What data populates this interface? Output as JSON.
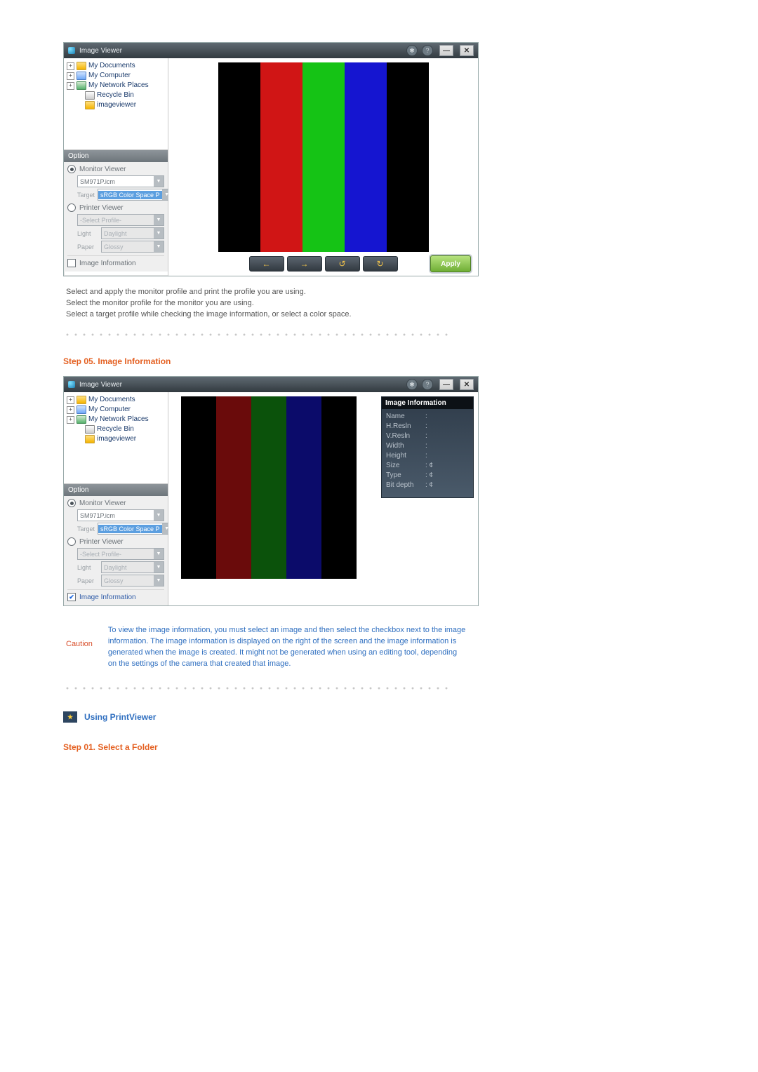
{
  "screenshot1": {
    "title": "Image Viewer",
    "tree": {
      "items": [
        {
          "label": "My Documents",
          "exp": "+",
          "icon": "folder"
        },
        {
          "label": "My Computer",
          "exp": "+",
          "icon": "comp"
        },
        {
          "label": "My Network Places",
          "exp": "+",
          "icon": "net"
        },
        {
          "label": "Recycle Bin",
          "exp": " ",
          "icon": "bin",
          "indent": 1
        },
        {
          "label": "imageviewer",
          "exp": " ",
          "icon": "folder",
          "indent": 1
        }
      ]
    },
    "option_header": "Option",
    "monitor_viewer": {
      "label": "Monitor Viewer",
      "selected": true
    },
    "profile_value": "SM971P.icm",
    "target_label": "Target",
    "target_value": "sRGB Color Space P",
    "printer_viewer": {
      "label": "Printer Viewer",
      "selected": false
    },
    "printer_profile_value": "-Select Profile-",
    "light_label": "Light",
    "light_value": "Daylight",
    "paper_label": "Paper",
    "paper_value": "Glossy",
    "image_info_label": "Image Information",
    "image_info_checked": false,
    "apply_label": "Apply",
    "nav": {
      "back": "←",
      "fwd": "→",
      "rot1": "↺",
      "rot2": "↻"
    },
    "bars": [
      "#000000",
      "#d01515",
      "#15c315",
      "#1515d0",
      "#000000"
    ]
  },
  "screenshot2": {
    "title": "Image Viewer",
    "info_panel": {
      "title": "Image Information",
      "rows": [
        {
          "k": "Name",
          "v": ":"
        },
        {
          "k": "H.Resln",
          "v": ":"
        },
        {
          "k": "V.Resln",
          "v": ":"
        },
        {
          "k": "Width",
          "v": ":"
        },
        {
          "k": "Height",
          "v": ":"
        },
        {
          "k": "Size",
          "v": ": ¢"
        },
        {
          "k": "Type",
          "v": ": ¢"
        },
        {
          "k": "Bit depth",
          "v": ": ¢"
        }
      ]
    },
    "image_info_checked": true,
    "bars": [
      "#000000",
      "#6a0b0b",
      "#0b520b",
      "#0b0b6a",
      "#000000"
    ]
  },
  "body_after_s1": {
    "l1": "Select and apply the monitor profile and print the profile you are using.",
    "l2": "Select the monitor profile for the monitor you are using.",
    "l3": "Select a target profile while checking the image information, or select a color space."
  },
  "step05_title": "Step 05. Image Information",
  "caution": {
    "label": "Caution",
    "text": "To view the image information, you must select an image and then select the checkbox next to the image information. The image information is displayed on the right of the screen and the image information is generated when the image is created. It might not be generated when using an editing tool, depending on the settings of the camera that created that image."
  },
  "using_printviewer": "Using PrintViewer",
  "step01_title": "Step 01. Select a Folder"
}
